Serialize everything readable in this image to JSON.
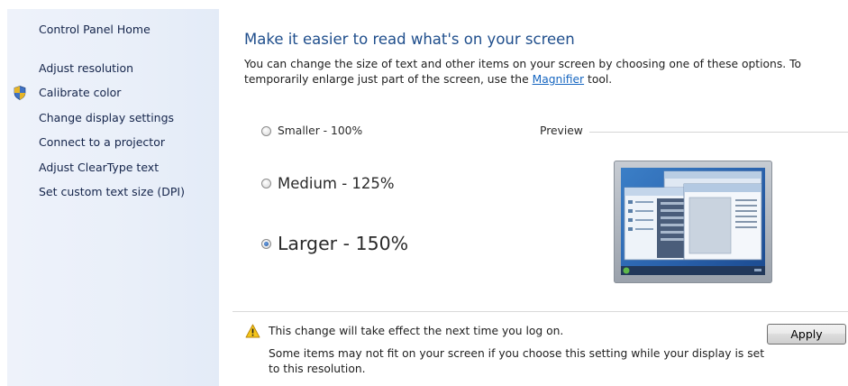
{
  "sidebar": {
    "home": "Control Panel Home",
    "items": [
      "Adjust resolution",
      "Calibrate color",
      "Change display settings",
      "Connect to a projector",
      "Adjust ClearType text",
      "Set custom text size (DPI)"
    ],
    "shield_icon": "uac-shield-icon"
  },
  "main": {
    "title": "Make it easier to read what's on your screen",
    "desc_before": "You can change the size of text and other items on your screen by choosing one of these options. To temporarily enlarge just part of the screen, use the ",
    "desc_link": "Magnifier",
    "desc_after": " tool.",
    "options": [
      {
        "label": "Smaller - 100%",
        "selected": false
      },
      {
        "label": "Medium - 125%",
        "selected": false
      },
      {
        "label": "Larger - 150%",
        "selected": true
      }
    ],
    "preview_label": "Preview",
    "warning_icon": "warning-icon",
    "warning_line1": "This change will take effect the next time you log on.",
    "warning_line2": "Some items may not fit on your screen if you choose this setting while your display is set to this resolution.",
    "apply_label": "Apply"
  },
  "colors": {
    "title": "#1f4e8c",
    "link": "#1565c0",
    "sidebar_bg": "#e9eff9",
    "sidebar_text": "#15254b"
  }
}
